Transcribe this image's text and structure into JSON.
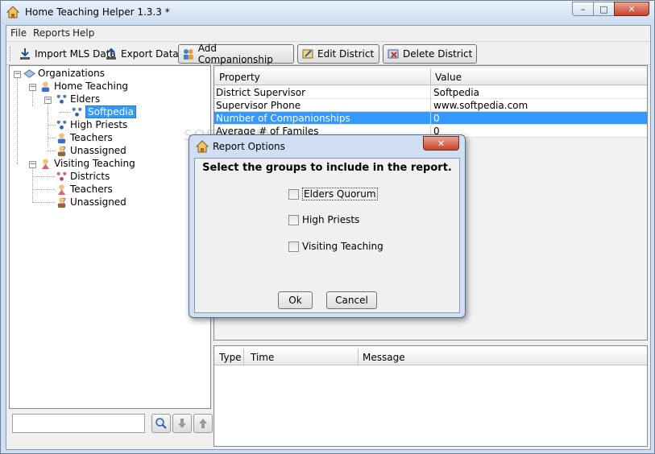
{
  "window": {
    "title": "Home Teaching Helper 1.3.3 *",
    "minimize": "–",
    "maximize": "□",
    "close": "✕"
  },
  "menu": {
    "items": [
      "File",
      "Reports",
      "Help"
    ]
  },
  "toolbar": {
    "import_label": "Import MLS Data",
    "export_label": "Export Data",
    "add_companionship_label": "Add Companionship",
    "edit_district_label": "Edit District",
    "delete_district_label": "Delete District"
  },
  "tree": {
    "root": "Organizations",
    "home_teaching": "Home Teaching",
    "elders": "Elders",
    "softpedia": "Softpedia",
    "high_priests": "High Priests",
    "teachers_ht": "Teachers",
    "unassigned_ht": "Unassigned",
    "visiting_teaching": "Visiting Teaching",
    "districts": "Districts",
    "teachers_vt": "Teachers",
    "unassigned_vt": "Unassigned"
  },
  "search": {
    "value": ""
  },
  "properties": {
    "headers": [
      "Property",
      "Value"
    ],
    "rows": [
      [
        "District Supervisor",
        "Softpedia"
      ],
      [
        "Supervisor Phone",
        "www.softpedia.com"
      ],
      [
        "Number of Companionships",
        "0"
      ],
      [
        "Average # of Familes",
        "0"
      ]
    ],
    "selected_row": 2
  },
  "log": {
    "headers": [
      "Type",
      "Time",
      "Message"
    ]
  },
  "dialog": {
    "title": "Report Options",
    "close": "✕",
    "heading": "Select the groups to include in the report.",
    "options": [
      "Elders Quorum",
      "High Priests",
      "Visiting Teaching"
    ],
    "ok_label": "Ok",
    "cancel_label": "Cancel"
  },
  "watermark": "SOFTPEDIA",
  "colors": {
    "selection": "#3399ff",
    "chrome": "#cfdff1",
    "close_button": "#c9432a"
  }
}
